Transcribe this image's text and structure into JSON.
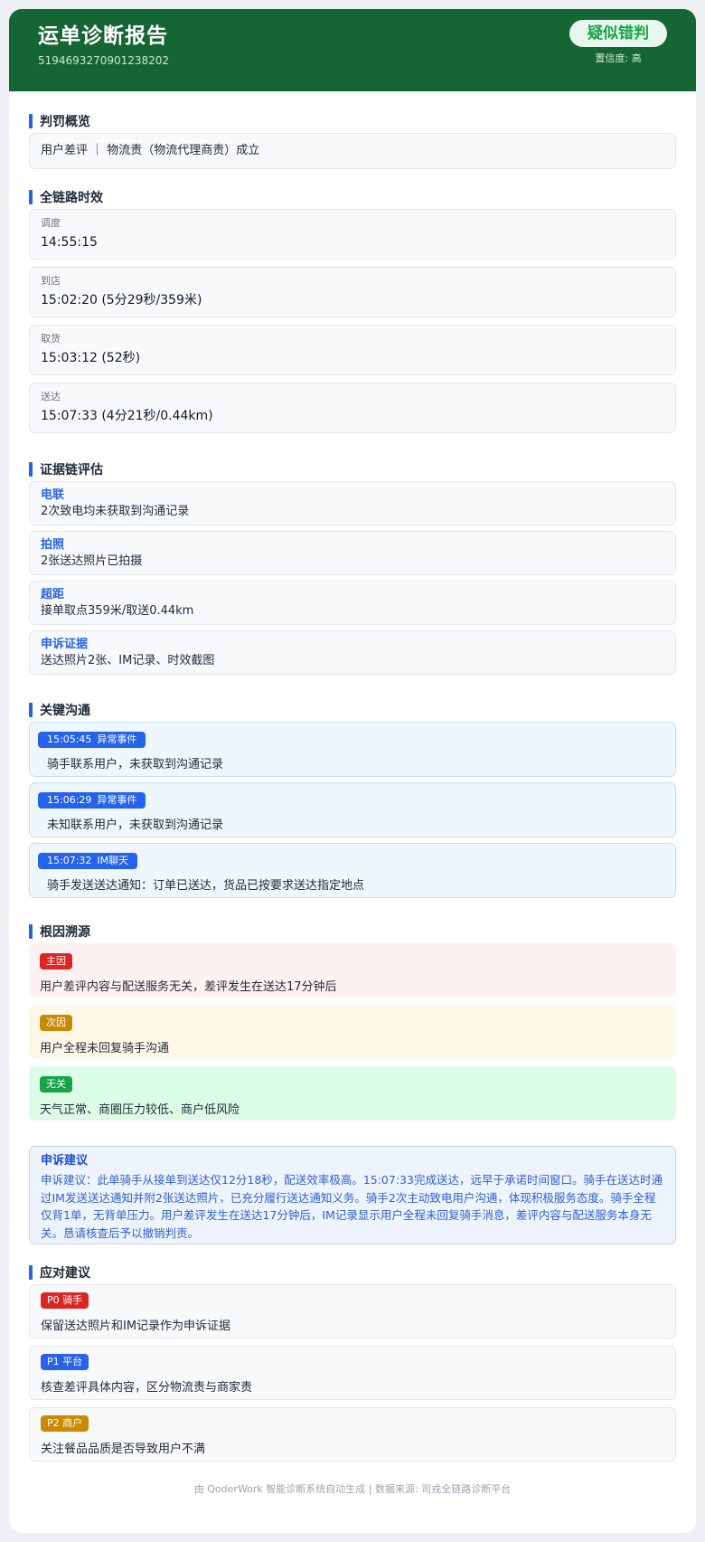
{
  "header": {
    "title": "运单诊断报告",
    "order_no": "5194693270901238202",
    "verdict": "疑似错判",
    "confidence": "置信度: 高"
  },
  "penalty": {
    "title": "判罚概览",
    "text": "用户差评 ｜ 物流责（物流代理商责）成立"
  },
  "timeline": {
    "title": "全链路时效",
    "items": [
      {
        "label": "调度",
        "value": "14:55:15"
      },
      {
        "label": "到店",
        "value": "15:02:20 (5分29秒/359米)"
      },
      {
        "label": "取货",
        "value": "15:03:12 (52秒)"
      },
      {
        "label": "送达",
        "value": "15:07:33 (4分21秒/0.44km)"
      }
    ]
  },
  "evidence": {
    "title": "证据链评估",
    "items": [
      {
        "label": "电联",
        "value": "2次致电均未获取到沟通记录"
      },
      {
        "label": "拍照",
        "value": "2张送达照片已拍摄"
      },
      {
        "label": "超距",
        "value": "接单取点359米/取送0.44km"
      },
      {
        "label": "申诉证据",
        "value": "送达照片2张、IM记录、时效截图"
      }
    ]
  },
  "communication": {
    "title": "关键沟通",
    "items": [
      {
        "time": "15:05:45",
        "type": "异常事件",
        "text": "骑手联系用户，未获取到沟通记录"
      },
      {
        "time": "15:06:29",
        "type": "异常事件",
        "text": "未知联系用户，未获取到沟通记录"
      },
      {
        "time": "15:07:32",
        "type": "IM聊天",
        "text": "骑手发送送达通知：订单已送达，货品已按要求送达指定地点"
      }
    ]
  },
  "root_cause": {
    "title": "根因溯源",
    "items": [
      {
        "tag": "主因",
        "text": "用户差评内容与配送服务无关，差评发生在送达17分钟后"
      },
      {
        "tag": "次因",
        "text": "用户全程未回复骑手沟通"
      },
      {
        "tag": "无关",
        "text": "天气正常、商圈压力较低、商户低风险"
      }
    ]
  },
  "appeal": {
    "title": "申诉建议",
    "body": "申诉建议：此单骑手从接单到送达仅12分18秒，配送效率极高。15:07:33完成送达，远早于承诺时间窗口。骑手在送达时通过IM发送送达通知并附2张送达照片，已充分履行送达通知义务。骑手2次主动致电用户沟通，体现积极服务态度。骑手全程仅背1单，无背单压力。用户差评发生在送达17分钟后，IM记录显示用户全程未回复骑手消息，差评内容与配送服务本身无关。恳请核查后予以撤销判责。"
  },
  "response": {
    "title": "应对建议",
    "items": [
      {
        "tag": "P0 骑手",
        "text": "保留送达照片和IM记录作为申诉证据"
      },
      {
        "tag": "P1 平台",
        "text": "核查差评具体内容，区分物流责与商家责"
      },
      {
        "tag": "P2 商户",
        "text": "关注餐品品质是否导致用户不满"
      }
    ]
  },
  "footer": "由 QoderWork 智能诊断系统自动生成 | 数据来源: 司戎全链路诊断平台",
  "colors": {
    "header_bg": "#166534",
    "accent": "#2563eb",
    "verdict": "#16a34a",
    "main_cause": "#dc2626",
    "secondary_cause": "#ca8a04",
    "unrelated": "#16a34a"
  }
}
